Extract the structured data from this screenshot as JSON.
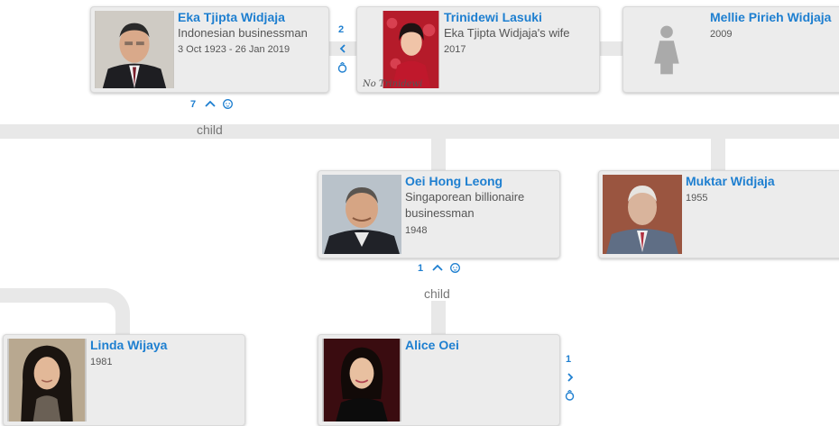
{
  "people": {
    "eka": {
      "name": "Eka Tjipta Widjaja",
      "desc": "Indonesian businessman",
      "date": "3 Oct 1923 - 26 Jan 2019"
    },
    "trinidewi": {
      "name": "Trinidewi Lasuki",
      "desc": "Eka Tjipta Widjaja's wife",
      "date": "2017",
      "photo_text": "No Trinidewi"
    },
    "mellie": {
      "name": "Mellie Pirieh Widjaja",
      "date": "2009"
    },
    "oei": {
      "name": "Oei Hong Leong",
      "desc": "Singaporean billionaire businessman",
      "date": "1948"
    },
    "muktar": {
      "name": "Muktar Widjaja",
      "date": "1955"
    },
    "linda": {
      "name": "Linda Wijaya",
      "date": "1981"
    },
    "alice": {
      "name": "Alice Oei"
    }
  },
  "controls": {
    "eka_spouse_count": "2",
    "eka_children_count": "7",
    "oei_children_count": "1",
    "alice_spouse_count": "1"
  },
  "labels": {
    "child_1": "child",
    "child_2": "child"
  },
  "icons": {
    "expand_left": "chevron-left-icon",
    "expand_right": "chevron-right-icon",
    "expand_up": "chevron-up-icon",
    "spouse": "ring-icon",
    "children": "baby-face-icon",
    "placeholder": "female-silhouette-icon"
  },
  "colors": {
    "link": "#1e7fd0",
    "card_bg": "#ececec",
    "connector": "#e8e8e8",
    "text": "#555555",
    "label": "#777777"
  }
}
